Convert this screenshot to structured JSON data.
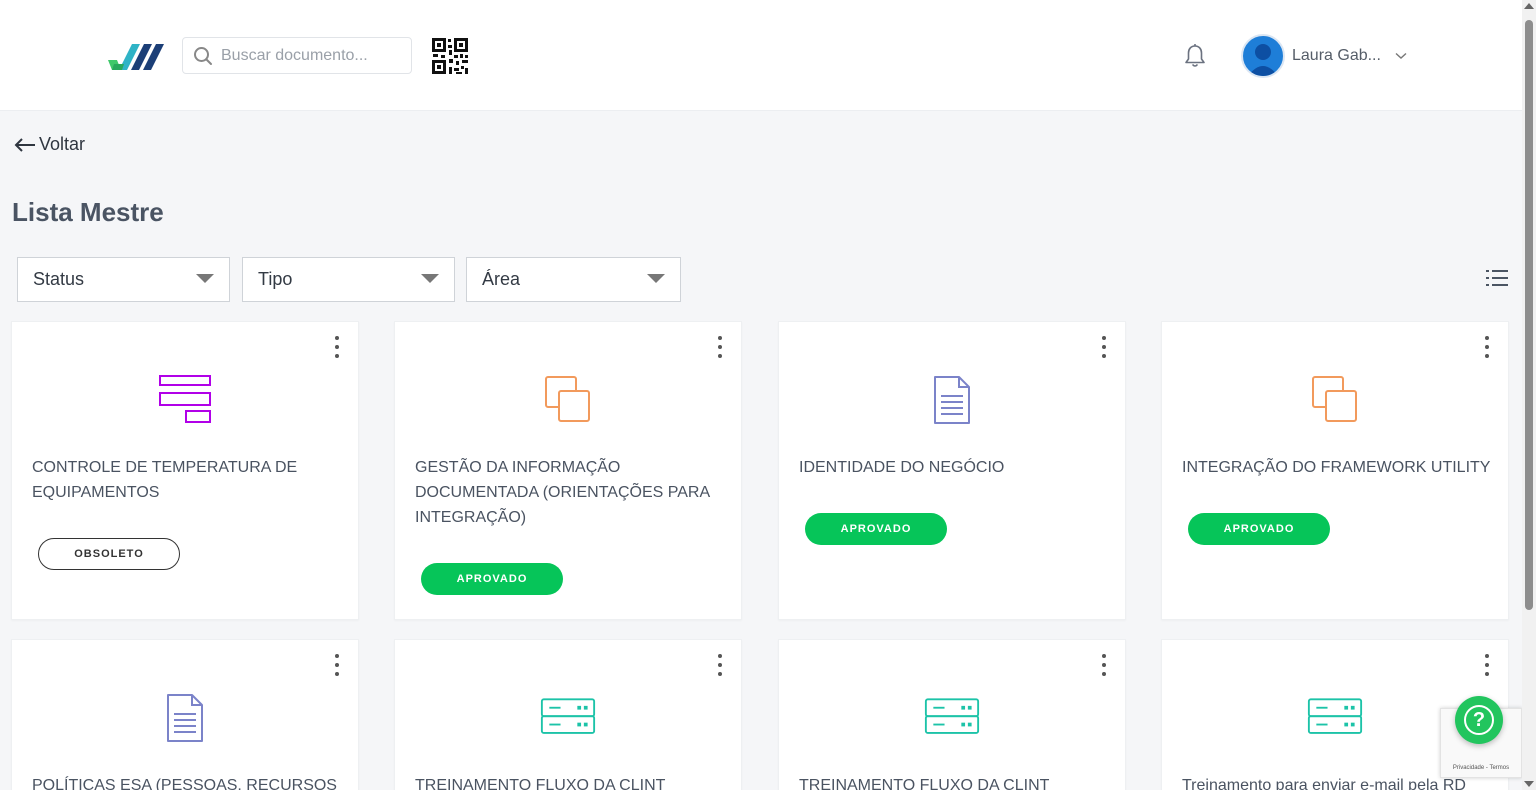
{
  "header": {
    "search_placeholder": "Buscar documento...",
    "user_name": "Laura Gab..."
  },
  "nav": {
    "back_label": "Voltar"
  },
  "page": {
    "title": "Lista Mestre"
  },
  "filters": [
    "Status",
    "Tipo",
    "Área"
  ],
  "cards": [
    {
      "title": "CONTROLE DE TEMPERATURA DE EQUIPAMENTOS",
      "status": "OBSOLETO",
      "icon": "layout-sections-icon",
      "icon_color": "#b100e8"
    },
    {
      "title": "GESTÃO DA INFORMAÇÃO DOCUMENTADA (ORIENTAÇÕES PARA INTEGRAÇÃO)",
      "status": "APROVADO",
      "icon": "copy-squares-icon",
      "icon_color": "#f29a5c"
    },
    {
      "title": "IDENTIDADE DO NEGÓCIO",
      "status": "APROVADO",
      "icon": "document-icon",
      "icon_color": "#7b83c9"
    },
    {
      "title": "INTEGRAÇÃO DO FRAMEWORK UTILITY",
      "status": "APROVADO",
      "icon": "copy-squares-icon",
      "icon_color": "#f29a5c"
    },
    {
      "title": "POLÍTICAS ESA (PESSOAS, RECURSOS E",
      "icon": "document-icon",
      "icon_color": "#7b83c9"
    },
    {
      "title": "TREINAMENTO FLUXO DA CLINT",
      "icon": "server-icon",
      "icon_color": "#1cc3a8"
    },
    {
      "title": "TREINAMENTO FLUXO DA CLINT",
      "icon": "server-icon",
      "icon_color": "#1cc3a8"
    },
    {
      "title": "Treinamento para enviar e-mail pela RD",
      "icon": "server-icon",
      "icon_color": "#1cc3a8"
    }
  ],
  "colors": {
    "approved": "#06c559",
    "help_button": "#22c55e"
  },
  "recaptcha": {
    "text": "Privacidade - Termos"
  }
}
